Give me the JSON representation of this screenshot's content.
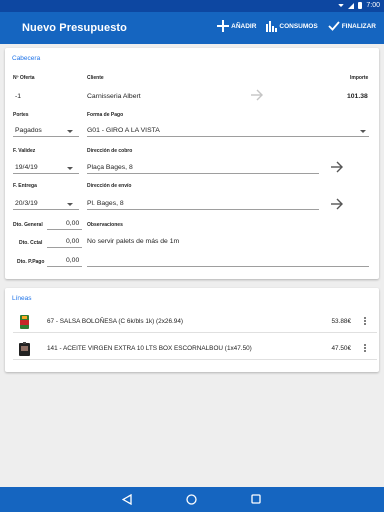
{
  "status_bar": {
    "time": "7:00"
  },
  "app_bar": {
    "title": "Nuevo Presupuesto",
    "actions": {
      "add": "AÑADIR",
      "consumos": "CONSUMOS",
      "finalizar": "FINALIZAR"
    }
  },
  "cabecera": {
    "title": "Cabecera",
    "labels": {
      "n_oferta": "Nº Oferta",
      "cliente": "Cliente",
      "importe": "Importe",
      "portes": "Portes",
      "forma_pago": "Forma de Pago",
      "f_validez": "F. Validez",
      "dir_cobro": "Dirección de cobro",
      "f_entrega": "F. Entrega",
      "dir_envio": "Dirección de envío",
      "dto_general": "Dto. General",
      "observaciones": "Observaciones",
      "dto_cctal": "Dto. Cctal",
      "dto_ppago": "Dto. P.Pago"
    },
    "values": {
      "n_oferta": "-1",
      "cliente": "Carnisseria Albert",
      "importe": "101.38",
      "portes": "Pagados",
      "forma_pago": "G01 - GIRO A LA VISTA",
      "f_validez": "19/4/19",
      "dir_cobro": "Plaça Bages, 8",
      "f_entrega": "20/3/19",
      "dir_envio": "Pl. Bages, 8",
      "dto_general": "0,00",
      "observaciones": "No servir palets de más de 1m",
      "dto_cctal": "0,00",
      "dto_ppago": "0,00"
    }
  },
  "lineas": {
    "title": "Líneas",
    "items": [
      {
        "description": "67 - SALSA BOLOÑESA (C 6k/bls 1k) (2x26.94)",
        "price": "53.88€"
      },
      {
        "description": "141 - ACEITE VIRGEN EXTRA 10 LTS BOX  ESCORNALBOU (1x47.50)",
        "price": "47.50€"
      }
    ]
  },
  "colors": {
    "app_bar": "#1565c0",
    "status_bar": "#0d47a1",
    "accent_text": "#1e73e8"
  }
}
